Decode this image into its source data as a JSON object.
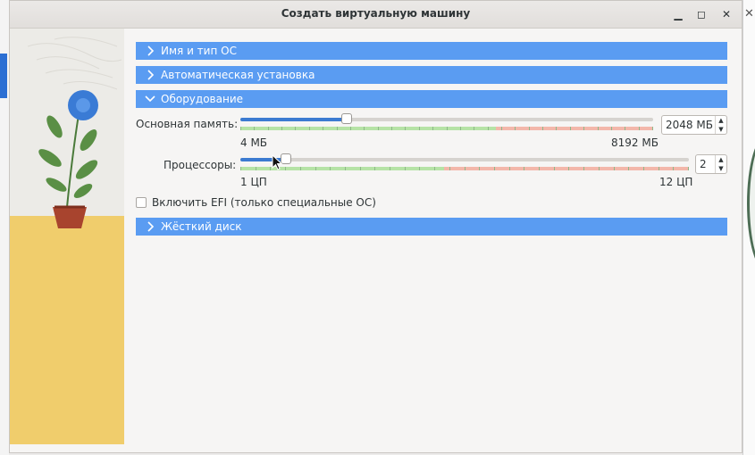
{
  "window": {
    "title": "Создать виртуальную машину"
  },
  "sections": {
    "name_os": "Имя и тип ОС",
    "unattended": "Автоматическая установка",
    "hardware": "Оборудование",
    "hard_disk": "Жёсткий диск"
  },
  "memory": {
    "label": "Основная память:",
    "value": "2048 МБ",
    "min_label": "4 МБ",
    "max_label": "8192 МБ",
    "fraction": 0.25
  },
  "cpu": {
    "label": "Процессоры:",
    "value": "2",
    "min_label": "1 ЦП",
    "max_label": "12 ЦП",
    "fraction": 0.0909
  },
  "efi": {
    "label": "Включить EFI (только специальные ОС)",
    "checked": false
  },
  "colors": {
    "section_bg": "#5a9cf2",
    "slider_fill": "#3c7bd1",
    "zone_green": "#b6e3a6",
    "zone_red": "#f3b7aa",
    "art_top": "#ecebe7",
    "art_bottom": "#f0cd6c"
  },
  "icons": {
    "chevron_collapsed": "chevron-right-icon",
    "chevron_expanded": "chevron-down-icon"
  }
}
